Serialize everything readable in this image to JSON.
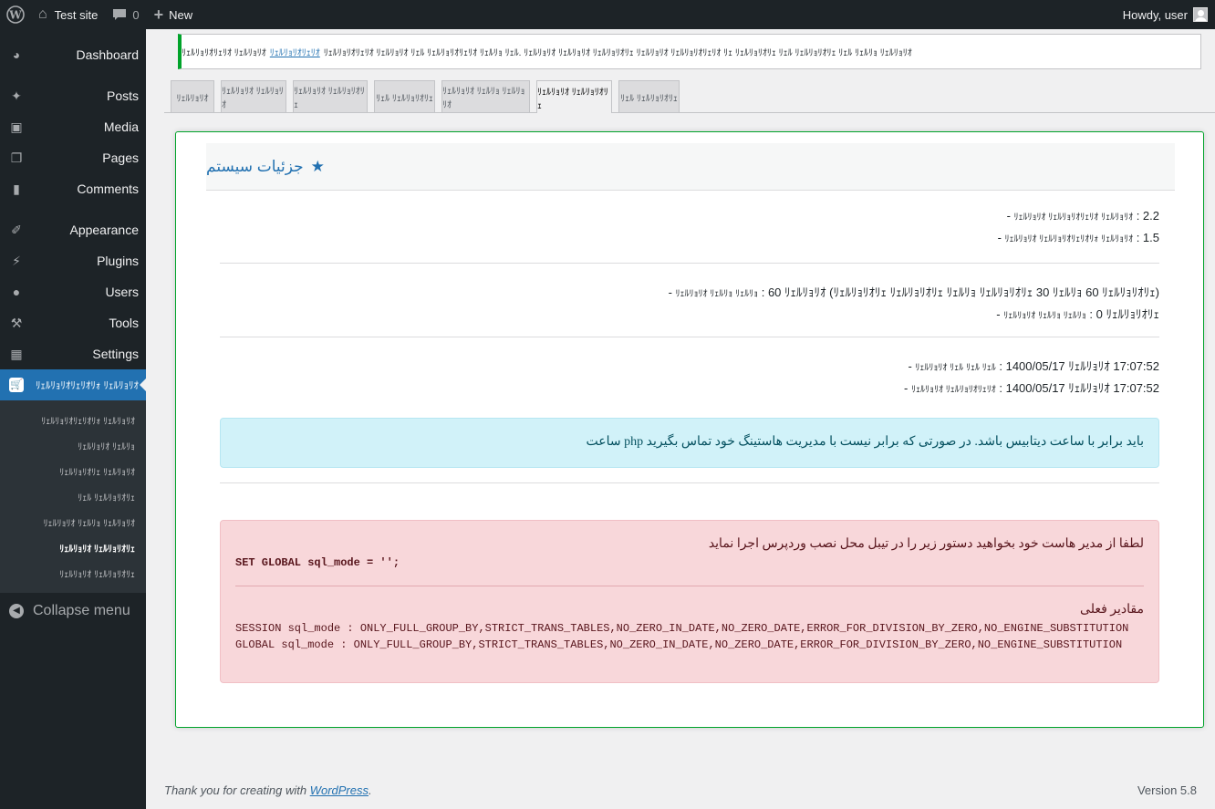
{
  "adminbar": {
    "site_name": "Test site",
    "comments_count": "0",
    "new_label": "New",
    "howdy": "Howdy, user"
  },
  "sidebar": {
    "items": [
      {
        "label": "Dashboard",
        "icon": "dashboard-icon"
      },
      {
        "label": "Posts",
        "icon": "pushpin-icon"
      },
      {
        "label": "Media",
        "icon": "media-icon"
      },
      {
        "label": "Pages",
        "icon": "pages-icon"
      },
      {
        "label": "Comments",
        "icon": "comment-icon"
      },
      {
        "label": "Appearance",
        "icon": "paintbrush-icon"
      },
      {
        "label": "Plugins",
        "icon": "plugin-icon"
      },
      {
        "label": "Users",
        "icon": "users-icon"
      },
      {
        "label": "Tools",
        "icon": "wrench-icon"
      },
      {
        "label": "Settings",
        "icon": "settings-icon"
      },
      {
        "label": "ﾘｪﾙﾘｮﾘｵﾘｪﾘｵﾘｫ ﾘｪﾙﾘｮﾘｵ",
        "icon": "cart-icon"
      }
    ],
    "submenu": [
      "ﾘｪﾙﾘｮﾘｵﾘｪﾘｵﾘｫ ﾘｪﾙﾘｮﾘｵ",
      "ﾘｪﾙﾘｮﾘｵ ﾘｪﾙﾘｮ",
      "ﾘｪﾙﾘｮﾘｵﾘｪ ﾘｪﾙﾘｮﾘｵ",
      "ﾘｪﾙ ﾘｪﾙﾘｮﾘｵﾘｪ",
      "ﾘｪﾙﾘｮﾘｵ ﾘｪﾙﾘｮ ﾘｪﾙﾘｮﾘｵ",
      "ﾘｪﾙﾘｮﾘｵ ﾘｪﾙﾘｮﾘｵﾘｪ",
      "ﾘｪﾙﾘｮﾘｵ ﾘｪﾙﾘｮﾘｵﾘｪ"
    ],
    "collapse": "Collapse menu"
  },
  "notice": {
    "text_before": "ﾘｪﾙﾘｮﾘｵﾘｪﾘｵ ﾘｪﾙﾘｮﾘｵ ﾘｪﾙ ﾘｪﾙﾘｮﾘｵﾘｪﾘｵ ﾘｪﾙﾘｮ ﾘｪﾙ. ﾘｪﾙﾘｮﾘｵ ﾘｪﾙﾘｮﾘｵ ﾘｪﾙﾘｮﾘｵﾘｪ ﾘｪﾙﾘｮﾘｵ ﾘｪﾙﾘｮﾘｵﾘｪﾘｵ ﾘｪ ﾘｪﾙﾘｮﾘｵﾘｪ ﾘｪﾙ ﾘｪﾙﾘｮﾘｵﾘｪ ﾘｪﾙ ﾘｪﾙﾘｮ ﾘｪﾙﾘｮﾘｵ",
    "link": "ﾘｪﾙﾘｮﾘｵﾘｪﾘｵ",
    "text_after": "ﾘｪﾙﾘｮﾘｵﾘｪﾘｵ ﾘｪﾙﾘｮﾘｵ"
  },
  "tabs": [
    "ﾘｪﾙﾘｮﾘｵ",
    "ﾘｪﾙﾘｮﾘｵ ﾘｪﾙﾘｮﾘｵ",
    "ﾘｪﾙﾘｮﾘｵ ﾘｪﾙﾘｮﾘｵﾘｪ",
    "ﾘｪﾙ ﾘｪﾙﾘｮﾘｵﾘｪ",
    "ﾘｪﾙﾘｮﾘｵ ﾘｪﾙﾘｮ ﾘｪﾙﾘｮﾘｵ",
    "ﾘｪﾙﾘｮﾘｵ ﾘｪﾙﾘｮﾘｵﾘｪ",
    "ﾘｪﾙ ﾘｪﾙﾘｮﾘｵﾘｪ"
  ],
  "panel": {
    "title": "جزئیات سیستم",
    "lines": [
      {
        "label": "ﾘｪﾙﾘｮﾘｵ ﾘｪﾙﾘｮﾘｵﾘｪﾘｵ ﾘｪﾙﾘｮﾘｵ",
        "value": ": 2.2 -"
      },
      {
        "label": "ﾘｪﾙﾘｮﾘｵ ﾘｪﾙﾘｮﾘｵﾘｪﾘｵﾘｫ ﾘｪﾙﾘｮﾘｵ",
        "value": ": 1.5 -"
      },
      {
        "label": "ﾘｪﾙﾘｮﾘｵ ﾘｪﾙﾘｮ ﾘｪﾙﾘｮ",
        "value": ": 60 ﾘｪﾙﾘｮﾘｵ (ﾘｪﾙﾘｮﾘｵﾘｪ ﾘｪﾙﾘｮﾘｵﾘｪ ﾘｪﾙﾘｮ ﾘｪﾙﾘｮﾘｵﾘｪ 30 ﾘｪﾙﾘｮ 60 ﾘｪﾙﾘｮﾘｵﾘｪ) -"
      },
      {
        "label": "ﾘｪﾙﾘｮﾘｵ ﾘｪﾙﾘｮ ﾘｪﾙﾘｮ",
        "value": ": 0 ﾘｪﾙﾘｮﾘｵﾘｪ -"
      },
      {
        "label": "ﾘｪﾙﾘｮﾘｵ ﾘｪﾙ ﾘｪﾙ ﾘｪﾙ",
        "value": ": 1400/05/17 ﾘｪﾙﾘｮﾘｵ 17:07:52 -"
      },
      {
        "label": "ﾘｪﾙﾘｮﾘｵ ﾘｪﾙﾘｮﾘｵﾘｪﾘｵ",
        "value": ": 1400/05/17 ﾘｪﾙﾘｮﾘｵ 17:07:52 -"
      }
    ],
    "info": "باید برابر با ساعت دیتابیس باشد. در صورتی که برابر نیست با مدیریت هاستینگ خود تماس بگیرید php ساعت",
    "error_title": "لطفا از مدیر هاست خود بخواهید دستور زیر را در تیبل محل نصب وردپرس اجرا نماید",
    "error_command": "SET GLOBAL sql_mode = '';",
    "current_label": "مقادیر فعلی",
    "session_mode": "SESSION sql_mode : ONLY_FULL_GROUP_BY,STRICT_TRANS_TABLES,NO_ZERO_IN_DATE,NO_ZERO_DATE,ERROR_FOR_DIVISION_BY_ZERO,NO_ENGINE_SUBSTITUTION",
    "global_mode": "GLOBAL sql_mode : ONLY_FULL_GROUP_BY,STRICT_TRANS_TABLES,NO_ZERO_IN_DATE,NO_ZERO_DATE,ERROR_FOR_DIVISION_BY_ZERO,NO_ENGINE_SUBSTITUTION"
  },
  "footer": {
    "thanks": "Thank you for creating with ",
    "wp_link": "WordPress",
    "period": ".",
    "version": "Version 5.8"
  },
  "colors": {
    "accent": "#2271b1",
    "success": "#00a32a",
    "admin_bg": "#1d2327"
  }
}
